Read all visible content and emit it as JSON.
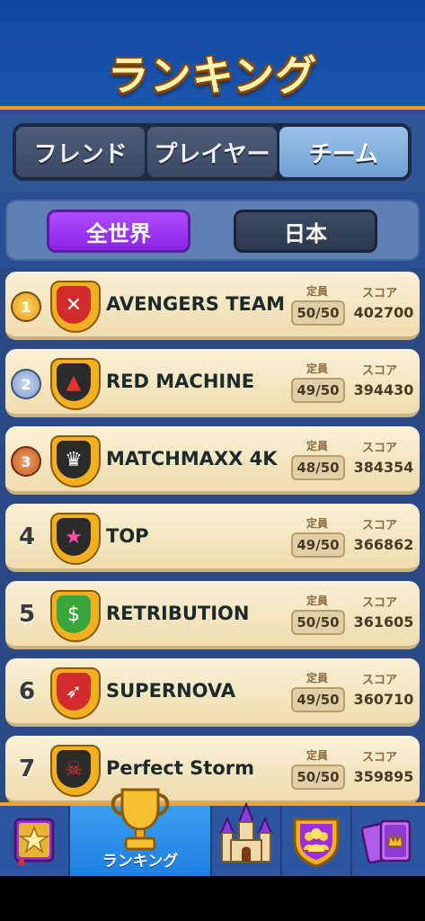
{
  "header": {
    "title": "ランキング"
  },
  "tabs": [
    {
      "label": "フレンド",
      "active": false
    },
    {
      "label": "プレイヤー",
      "active": false
    },
    {
      "label": "チーム",
      "active": true
    }
  ],
  "region": {
    "world": "全世界",
    "japan": "日本",
    "selected": "全世界"
  },
  "columns": {
    "capacity": "定員",
    "score": "スコア"
  },
  "teams": [
    {
      "rank": "1",
      "name": "AVENGERS TEAM",
      "capacity": "50/50",
      "score": "402700",
      "icon": "crossed-swords-icon",
      "color": "#d12b2b"
    },
    {
      "rank": "2",
      "name": "RED MACHINE",
      "capacity": "49/50",
      "score": "394430",
      "icon": "flame-icon",
      "color": "#2b2b2b"
    },
    {
      "rank": "3",
      "name": "MATCHMAXX 4K",
      "capacity": "48/50",
      "score": "384354",
      "icon": "crown-icon",
      "color": "#2b2b2b"
    },
    {
      "rank": "4",
      "name": "TOP",
      "capacity": "49/50",
      "score": "366862",
      "icon": "star-icon",
      "color": "#2b2b2b"
    },
    {
      "rank": "5",
      "name": "RETRIBUTION",
      "capacity": "50/50",
      "score": "361605",
      "icon": "money-bag-icon",
      "color": "#3aa53a"
    },
    {
      "rank": "6",
      "name": "SUPERNOVA",
      "capacity": "49/50",
      "score": "360710",
      "icon": "rocket-icon",
      "color": "#d12b2b"
    },
    {
      "rank": "7",
      "name": "Perfect Storm",
      "capacity": "50/50",
      "score": "359895",
      "icon": "skull-icon",
      "color": "#2b2b2b"
    }
  ],
  "nav": {
    "ranking_label": "ランキング"
  }
}
